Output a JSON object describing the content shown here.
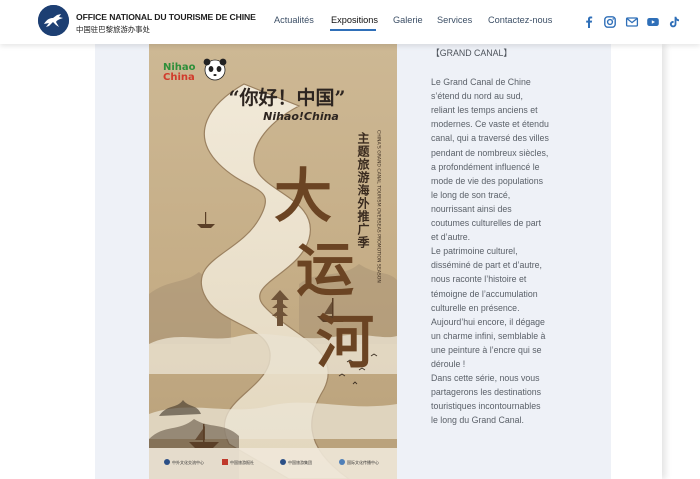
{
  "header": {
    "brand_name": "OFFICE NATIONAL DU TOURISME DE CHINE",
    "brand_name_cn": "中国驻巴黎旅游办事处",
    "logo_icon": "flying-horse-logo-icon"
  },
  "nav": {
    "items": [
      {
        "label": "Actualités",
        "active": false
      },
      {
        "label": "Expositions",
        "active": true
      },
      {
        "label": "Galerie",
        "active": false
      },
      {
        "label": "Services",
        "active": false
      },
      {
        "label": "Contactez-nous",
        "active": false
      }
    ]
  },
  "social": [
    "facebook-icon",
    "instagram-icon",
    "email-icon",
    "youtube-icon",
    "tiktok-icon"
  ],
  "poster": {
    "badge_nihao": "Nihao",
    "badge_china": "China",
    "headline_cn": "“你好！中国”",
    "headline_en": "Nihao!China",
    "subtitle_cn": "主题旅游海外推广季",
    "subtitle_en": "CHINA'S GRAND CANAL TOURISM OVERSEAS PROMOTION SEASON",
    "big_chars": [
      "大",
      "运",
      "河"
    ],
    "sponsors": [
      "中外文化交流中心",
      "中国旅游报社",
      "中国旅游集团",
      "国际文化传播中心"
    ]
  },
  "article": {
    "title": "【GRAND CANAL】",
    "paragraphs": [
      "Le Grand Canal de Chine s’étend du nord au sud, reliant les temps anciens et modernes. Ce vaste et étendu canal, qui a traversé des villes pendant de nombreux siècles, a profondément influencé le mode de vie des populations le long de son tracé, nourrissant ainsi des coutumes culturelles de part et d’autre.",
      "Le patrimoine culturel, disséminé de part et d’autre, nous raconte l’histoire et témoigne de l’accumulation culturelle en présence. Aujourd’hui encore, il dégage un charme infini, semblable à une peinture à l’encre qui se déroule !",
      "Dans cette série, nous vous partagerons les destinations touristiques incontournables le long du Grand Canal."
    ]
  },
  "colors": {
    "brand_blue": "#1d3f73",
    "nav_active_underline": "#2f6fb8",
    "panel_bg": "#eef1f7",
    "poster_bg": "#c9b38d",
    "poster_text": "#5b3a1e"
  }
}
